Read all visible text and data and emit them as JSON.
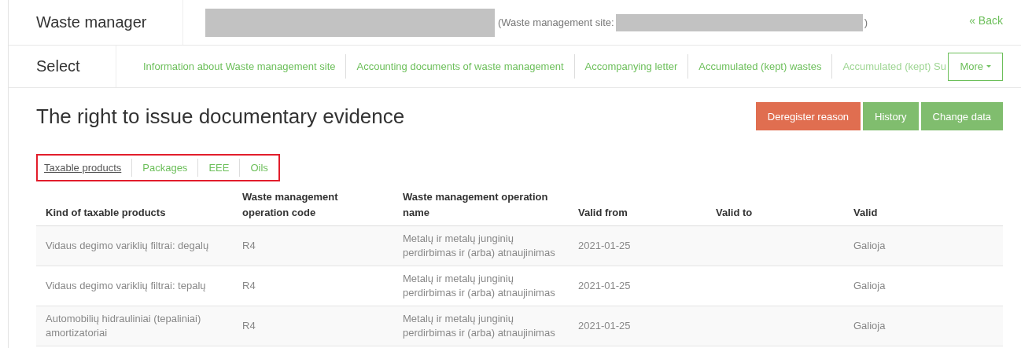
{
  "header": {
    "title": "Waste manager",
    "site_prefix": "(Waste management site:",
    "site_suffix": ")",
    "back_link": "« Back"
  },
  "nav": {
    "label": "Select",
    "items": [
      {
        "label": "Information about Waste management site"
      },
      {
        "label": "Accounting documents of waste management"
      },
      {
        "label": "Accompanying letter"
      },
      {
        "label": "Accumulated (kept) wastes"
      },
      {
        "label": "Accumulated (kept) Su"
      }
    ],
    "more_button": "More"
  },
  "page_title": "The right to issue documentary evidence",
  "actions": [
    {
      "label": "Deregister reason",
      "kind": "danger"
    },
    {
      "label": "History",
      "kind": "success"
    },
    {
      "label": "Change data",
      "kind": "success"
    }
  ],
  "tabs_highlighted": true,
  "tabs": [
    {
      "label": "Taxable products",
      "selected": true
    },
    {
      "label": "Packages",
      "selected": false
    },
    {
      "label": "EEE",
      "selected": false
    },
    {
      "label": "Oils",
      "selected": false
    }
  ],
  "table": {
    "columns": [
      "Kind of taxable products",
      "Waste management operation code",
      "Waste management operation name",
      "Valid from",
      "Valid to",
      "Valid"
    ],
    "rows": [
      [
        "Vidaus degimo variklių filtrai: degalų",
        "R4",
        "Metalų ir metalų junginių perdirbimas ir (arba) atnaujinimas",
        "2021-01-25",
        "",
        "Galioja"
      ],
      [
        "Vidaus degimo variklių filtrai: tepalų",
        "R4",
        "Metalų ir metalų junginių perdirbimas ir (arba) atnaujinimas",
        "2021-01-25",
        "",
        "Galioja"
      ],
      [
        "Automobilių hidrauliniai (tepaliniai) amortizatoriai",
        "R4",
        "Metalų ir metalų junginių perdirbimas ir (arba) atnaujinimas",
        "2021-01-25",
        "",
        "Galioja"
      ]
    ]
  }
}
